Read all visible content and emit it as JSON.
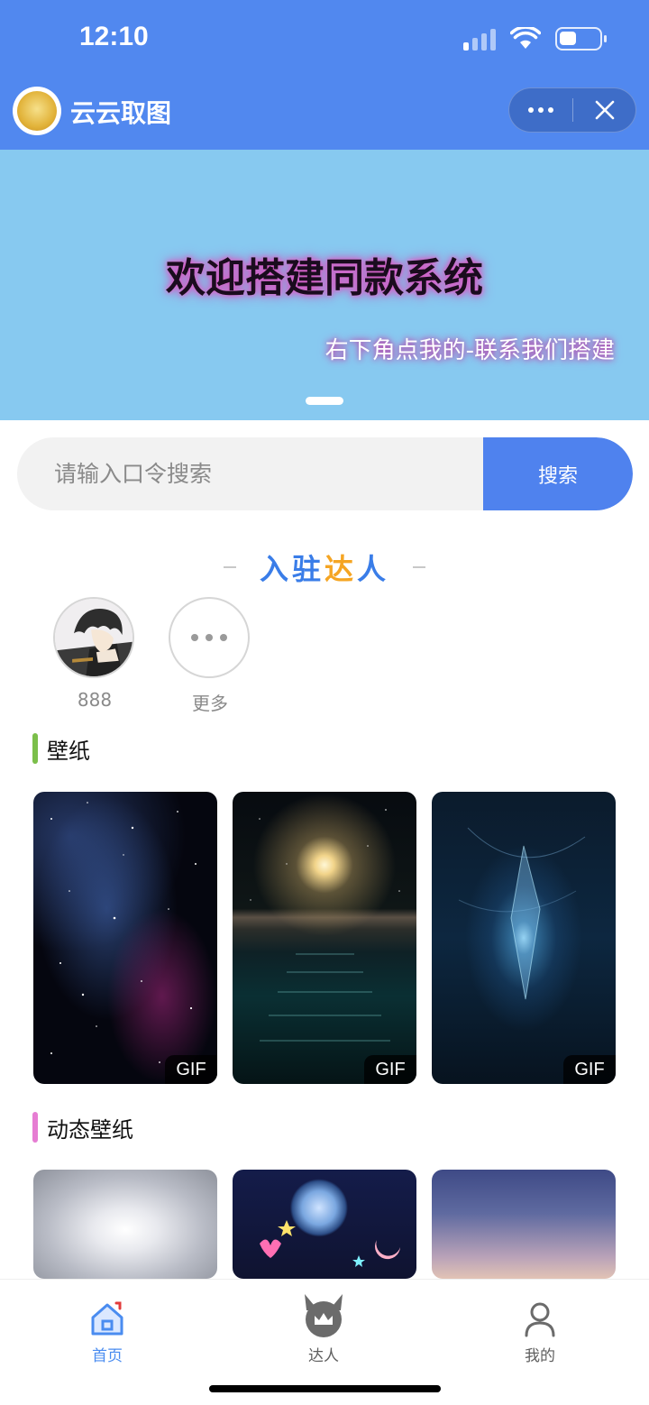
{
  "status_bar": {
    "time": "12:10"
  },
  "nav": {
    "app_name": "云云取图"
  },
  "banner": {
    "title": "欢迎搭建同款系统",
    "subtitle": "右下角点我的-联系我们搭建"
  },
  "search": {
    "placeholder": "请输入口令搜索",
    "value": "",
    "button_label": "搜索"
  },
  "creators_section": {
    "title_part1": "入驻",
    "title_part2": "达",
    "title_part3": "人",
    "creators": [
      {
        "name": "888"
      },
      {
        "name": "更多"
      }
    ]
  },
  "categories": [
    {
      "label": "壁纸",
      "accent": "#7bbf4a",
      "items": [
        {
          "badge": "GIF"
        },
        {
          "badge": "GIF"
        },
        {
          "badge": "GIF"
        }
      ]
    },
    {
      "label": "动态壁纸",
      "accent": "#e67dd3",
      "items": [
        {},
        {},
        {}
      ]
    }
  ],
  "tabbar": {
    "items": [
      {
        "label": "首页",
        "icon": "home-icon",
        "active": true,
        "color": "#4a8cf0"
      },
      {
        "label": "达人",
        "icon": "crown-icon",
        "active": false,
        "color": "#5f5f5f"
      },
      {
        "label": "我的",
        "icon": "user-icon",
        "active": false,
        "color": "#5f5f5f"
      }
    ]
  },
  "colors": {
    "primary": "#5188ef",
    "search_button": "#4f82ee",
    "banner_bg": "#87c9f0"
  }
}
